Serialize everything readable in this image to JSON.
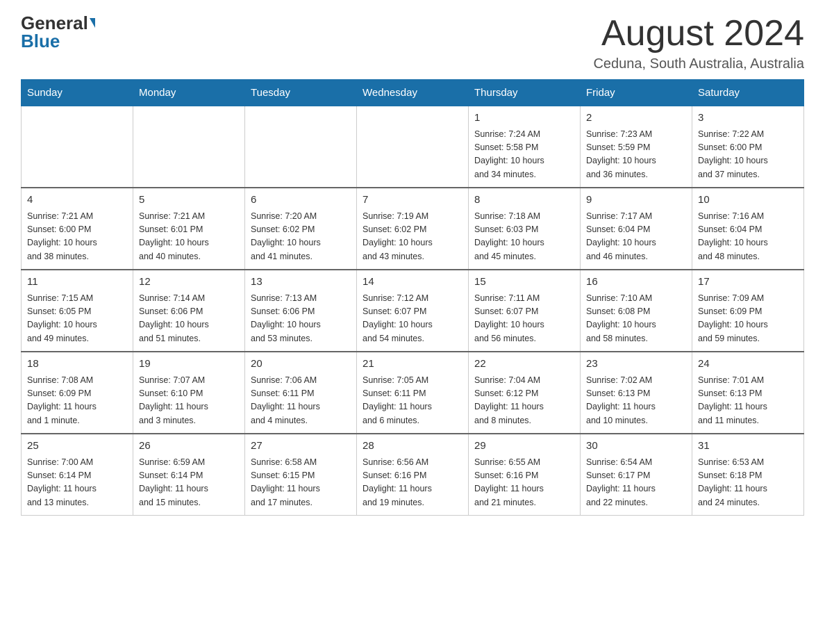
{
  "header": {
    "logo_general": "General",
    "logo_blue": "Blue",
    "title": "August 2024",
    "subtitle": "Ceduna, South Australia, Australia"
  },
  "days_of_week": [
    "Sunday",
    "Monday",
    "Tuesday",
    "Wednesday",
    "Thursday",
    "Friday",
    "Saturday"
  ],
  "weeks": [
    [
      {
        "day": "",
        "info": ""
      },
      {
        "day": "",
        "info": ""
      },
      {
        "day": "",
        "info": ""
      },
      {
        "day": "",
        "info": ""
      },
      {
        "day": "1",
        "info": "Sunrise: 7:24 AM\nSunset: 5:58 PM\nDaylight: 10 hours\nand 34 minutes."
      },
      {
        "day": "2",
        "info": "Sunrise: 7:23 AM\nSunset: 5:59 PM\nDaylight: 10 hours\nand 36 minutes."
      },
      {
        "day": "3",
        "info": "Sunrise: 7:22 AM\nSunset: 6:00 PM\nDaylight: 10 hours\nand 37 minutes."
      }
    ],
    [
      {
        "day": "4",
        "info": "Sunrise: 7:21 AM\nSunset: 6:00 PM\nDaylight: 10 hours\nand 38 minutes."
      },
      {
        "day": "5",
        "info": "Sunrise: 7:21 AM\nSunset: 6:01 PM\nDaylight: 10 hours\nand 40 minutes."
      },
      {
        "day": "6",
        "info": "Sunrise: 7:20 AM\nSunset: 6:02 PM\nDaylight: 10 hours\nand 41 minutes."
      },
      {
        "day": "7",
        "info": "Sunrise: 7:19 AM\nSunset: 6:02 PM\nDaylight: 10 hours\nand 43 minutes."
      },
      {
        "day": "8",
        "info": "Sunrise: 7:18 AM\nSunset: 6:03 PM\nDaylight: 10 hours\nand 45 minutes."
      },
      {
        "day": "9",
        "info": "Sunrise: 7:17 AM\nSunset: 6:04 PM\nDaylight: 10 hours\nand 46 minutes."
      },
      {
        "day": "10",
        "info": "Sunrise: 7:16 AM\nSunset: 6:04 PM\nDaylight: 10 hours\nand 48 minutes."
      }
    ],
    [
      {
        "day": "11",
        "info": "Sunrise: 7:15 AM\nSunset: 6:05 PM\nDaylight: 10 hours\nand 49 minutes."
      },
      {
        "day": "12",
        "info": "Sunrise: 7:14 AM\nSunset: 6:06 PM\nDaylight: 10 hours\nand 51 minutes."
      },
      {
        "day": "13",
        "info": "Sunrise: 7:13 AM\nSunset: 6:06 PM\nDaylight: 10 hours\nand 53 minutes."
      },
      {
        "day": "14",
        "info": "Sunrise: 7:12 AM\nSunset: 6:07 PM\nDaylight: 10 hours\nand 54 minutes."
      },
      {
        "day": "15",
        "info": "Sunrise: 7:11 AM\nSunset: 6:07 PM\nDaylight: 10 hours\nand 56 minutes."
      },
      {
        "day": "16",
        "info": "Sunrise: 7:10 AM\nSunset: 6:08 PM\nDaylight: 10 hours\nand 58 minutes."
      },
      {
        "day": "17",
        "info": "Sunrise: 7:09 AM\nSunset: 6:09 PM\nDaylight: 10 hours\nand 59 minutes."
      }
    ],
    [
      {
        "day": "18",
        "info": "Sunrise: 7:08 AM\nSunset: 6:09 PM\nDaylight: 11 hours\nand 1 minute."
      },
      {
        "day": "19",
        "info": "Sunrise: 7:07 AM\nSunset: 6:10 PM\nDaylight: 11 hours\nand 3 minutes."
      },
      {
        "day": "20",
        "info": "Sunrise: 7:06 AM\nSunset: 6:11 PM\nDaylight: 11 hours\nand 4 minutes."
      },
      {
        "day": "21",
        "info": "Sunrise: 7:05 AM\nSunset: 6:11 PM\nDaylight: 11 hours\nand 6 minutes."
      },
      {
        "day": "22",
        "info": "Sunrise: 7:04 AM\nSunset: 6:12 PM\nDaylight: 11 hours\nand 8 minutes."
      },
      {
        "day": "23",
        "info": "Sunrise: 7:02 AM\nSunset: 6:13 PM\nDaylight: 11 hours\nand 10 minutes."
      },
      {
        "day": "24",
        "info": "Sunrise: 7:01 AM\nSunset: 6:13 PM\nDaylight: 11 hours\nand 11 minutes."
      }
    ],
    [
      {
        "day": "25",
        "info": "Sunrise: 7:00 AM\nSunset: 6:14 PM\nDaylight: 11 hours\nand 13 minutes."
      },
      {
        "day": "26",
        "info": "Sunrise: 6:59 AM\nSunset: 6:14 PM\nDaylight: 11 hours\nand 15 minutes."
      },
      {
        "day": "27",
        "info": "Sunrise: 6:58 AM\nSunset: 6:15 PM\nDaylight: 11 hours\nand 17 minutes."
      },
      {
        "day": "28",
        "info": "Sunrise: 6:56 AM\nSunset: 6:16 PM\nDaylight: 11 hours\nand 19 minutes."
      },
      {
        "day": "29",
        "info": "Sunrise: 6:55 AM\nSunset: 6:16 PM\nDaylight: 11 hours\nand 21 minutes."
      },
      {
        "day": "30",
        "info": "Sunrise: 6:54 AM\nSunset: 6:17 PM\nDaylight: 11 hours\nand 22 minutes."
      },
      {
        "day": "31",
        "info": "Sunrise: 6:53 AM\nSunset: 6:18 PM\nDaylight: 11 hours\nand 24 minutes."
      }
    ]
  ]
}
